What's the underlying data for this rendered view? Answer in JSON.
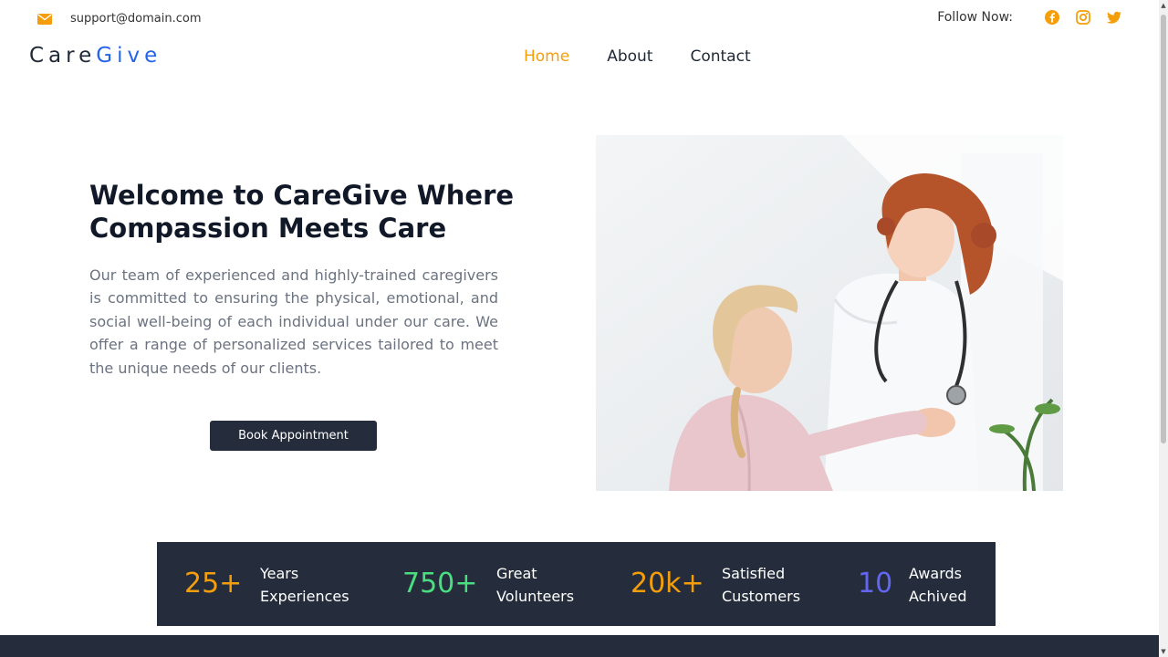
{
  "topbar": {
    "email": "support@domain.com",
    "email_icon": "envelope-icon",
    "follow_label": "Follow Now:",
    "socials": [
      {
        "name": "facebook-icon"
      },
      {
        "name": "instagram-icon"
      },
      {
        "name": "twitter-icon"
      }
    ]
  },
  "logo": {
    "part1": "Care",
    "part2": "Give"
  },
  "nav": {
    "items": [
      {
        "label": "Home",
        "active": true
      },
      {
        "label": "About",
        "active": false
      },
      {
        "label": "Contact",
        "active": false
      }
    ]
  },
  "hero": {
    "title_line1": "Welcome to CareGive Where",
    "title_line2": "Compassion Meets Care",
    "description": "Our team of experienced and highly-trained caregivers is committed to ensuring the physical, emotional, and social well-being of each individual under our care. We offer a range of personalized services tailored to meet the unique needs of our clients.",
    "button_label": "Book Appointment"
  },
  "stats": [
    {
      "value": "25+",
      "label_line1": "Years",
      "label_line2": "Experiences",
      "color": "#f59e0b"
    },
    {
      "value": "750+",
      "label_line1": "Great",
      "label_line2": "Volunteers",
      "color": "#4ade80"
    },
    {
      "value": "20k+",
      "label_line1": "Satisfied",
      "label_line2": "Customers",
      "color": "#f59e0b"
    },
    {
      "value": "10",
      "label_line1": "Awards",
      "label_line2": "Achived",
      "color": "#6366f1"
    }
  ],
  "colors": {
    "accent": "#f59e0b",
    "brand_blue": "#2563eb",
    "dark": "#252d3c"
  }
}
